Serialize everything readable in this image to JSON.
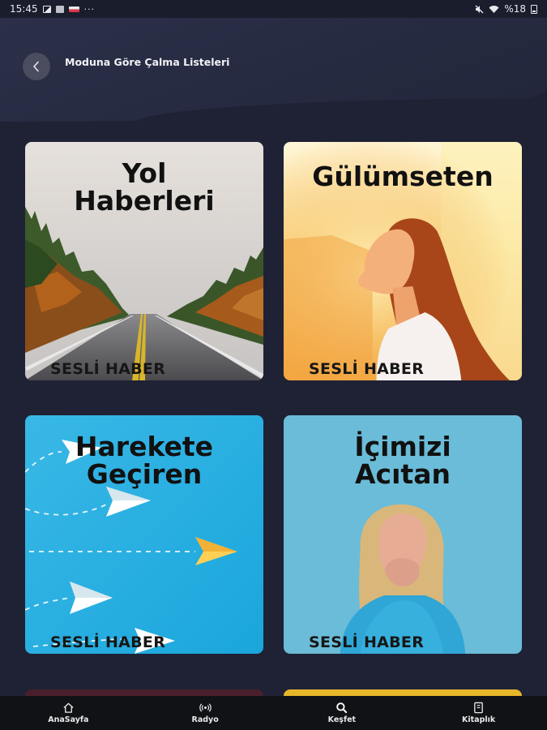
{
  "status_bar": {
    "time": "15:45",
    "dots": "···",
    "battery": "%18"
  },
  "header": {
    "title": "Moduna Göre Çalma Listeleri"
  },
  "cards": [
    {
      "title": "Yol\nHaberleri",
      "brand": "SESLİ HABER"
    },
    {
      "title": "Gülümseten",
      "brand": "SESLİ HABER"
    },
    {
      "title": "Harekete\nGeçiren",
      "brand": "SESLİ HABER"
    },
    {
      "title": "İçimizi\nAcıtan",
      "brand": "SESLİ HABER"
    }
  ],
  "colors": {
    "background": "#1f2235",
    "nav_background": "#111216",
    "card_yellow": "#e7b72a"
  },
  "bottom_nav": [
    {
      "label": "AnaSayfa",
      "icon": "home-icon"
    },
    {
      "label": "Radyo",
      "icon": "radio-icon"
    },
    {
      "label": "Keşfet",
      "icon": "search-icon"
    },
    {
      "label": "Kitaplık",
      "icon": "library-icon"
    }
  ]
}
